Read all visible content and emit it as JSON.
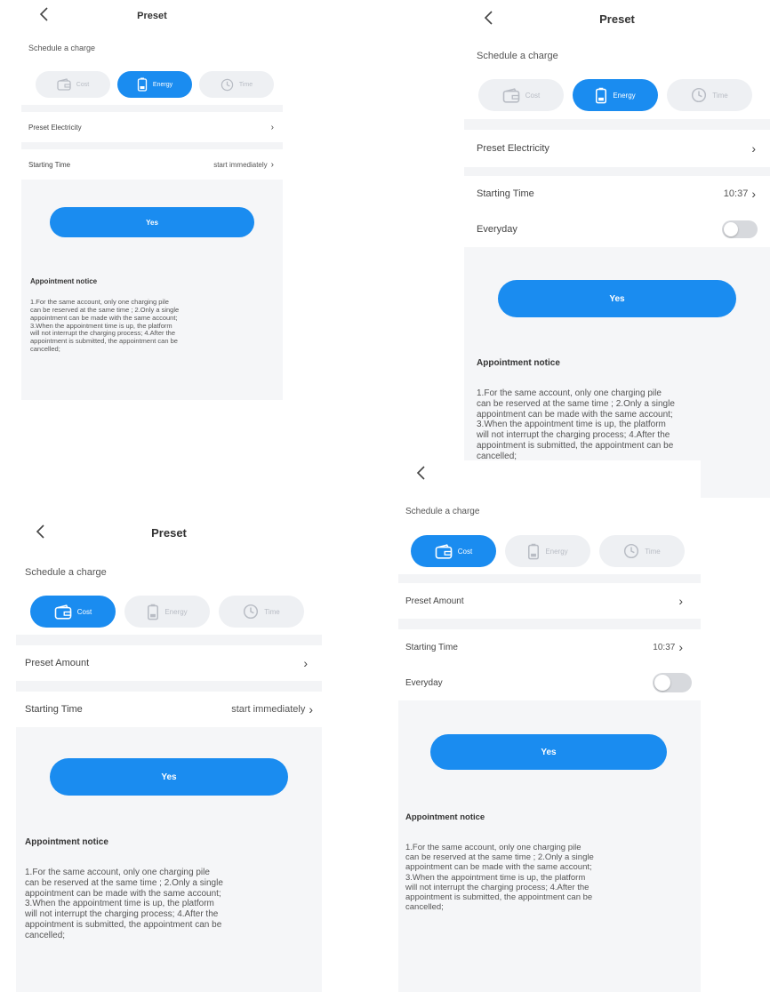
{
  "title": "Preset",
  "schedule_label": "Schedule a charge",
  "tabs": {
    "cost": "Cost",
    "energy": "Energy",
    "time": "Time"
  },
  "colors": {
    "accent": "#1a8cf0",
    "inactive_tab": "#eef0f3",
    "background": "#f5f6f8"
  },
  "icons": {
    "back": "chevron-left-icon",
    "cost": "wallet-icon",
    "energy": "battery-icon",
    "time": "clock-icon",
    "row": "chevron-right-icon"
  },
  "screens": [
    {
      "active_tab": "energy",
      "preset_row_label": "Preset Electricity",
      "starting_time_label": "Starting Time",
      "starting_time_value": "start immediately",
      "yes_label": "Yes"
    },
    {
      "active_tab": "energy",
      "preset_row_label": "Preset Electricity",
      "starting_time_label": "Starting Time",
      "starting_time_value": "10:37",
      "everyday_label": "Everyday",
      "everyday_on": false,
      "yes_label": "Yes"
    },
    {
      "active_tab": "cost",
      "preset_row_label": "Preset Amount",
      "starting_time_label": "Starting Time",
      "starting_time_value": "start immediately",
      "yes_label": "Yes"
    },
    {
      "active_tab": "cost",
      "preset_row_label": "Preset Amount",
      "starting_time_label": "Starting Time",
      "starting_time_value": "10:37",
      "everyday_label": "Everyday",
      "everyday_on": false,
      "yes_label": "Yes"
    }
  ],
  "notice": {
    "title": "Appointment notice",
    "lines": [
      "1.For the same account, only one charging pile",
      "can be reserved at the same time ; 2.Only a single",
      "appointment can be made with the same account;",
      "3.When the appointment time is up, the platform",
      "will not interrupt the charging process; 4.After the",
      "appointment is submitted, the appointment can be",
      "cancelled;"
    ]
  }
}
